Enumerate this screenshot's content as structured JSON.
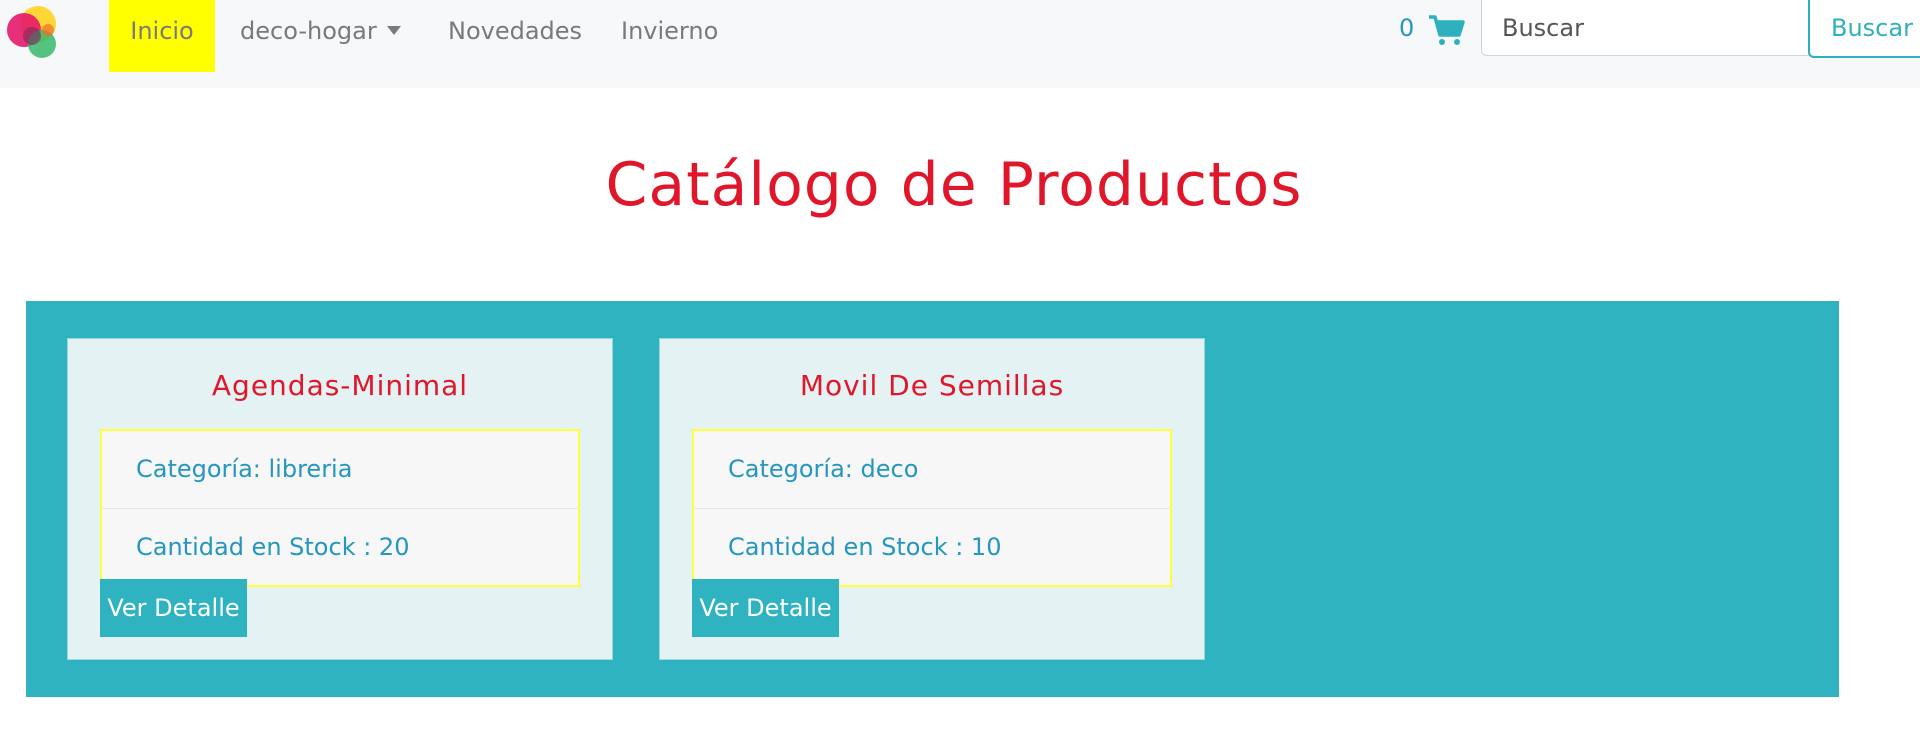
{
  "navbar": {
    "logo": "logo",
    "links": [
      {
        "label": "Inicio",
        "active": true
      },
      {
        "label": "deco-hogar",
        "dropdown": true
      },
      {
        "label": "Novedades"
      },
      {
        "label": "Invierno"
      }
    ],
    "cart": {
      "count": "0",
      "icon": "shopping-cart-icon"
    },
    "search": {
      "placeholder": "Buscar",
      "button_label": "Buscar"
    }
  },
  "page": {
    "title": "Catálogo de Productos"
  },
  "products": [
    {
      "name": "Agendas-Minimal",
      "category": "Categoría: libreria",
      "stock": "Cantidad en Stock : 20",
      "button_label": "Ver Detalle"
    },
    {
      "name": "Movil De Semillas",
      "category": "Categoría: deco",
      "stock": "Cantidad en Stock : 10",
      "button_label": "Ver Detalle"
    }
  ],
  "colors": {
    "active_nav": "#ffff00",
    "title": "#e0162b",
    "accent": "#2fb3c1",
    "link": "#2596be",
    "info_border": "#ffff3a"
  }
}
